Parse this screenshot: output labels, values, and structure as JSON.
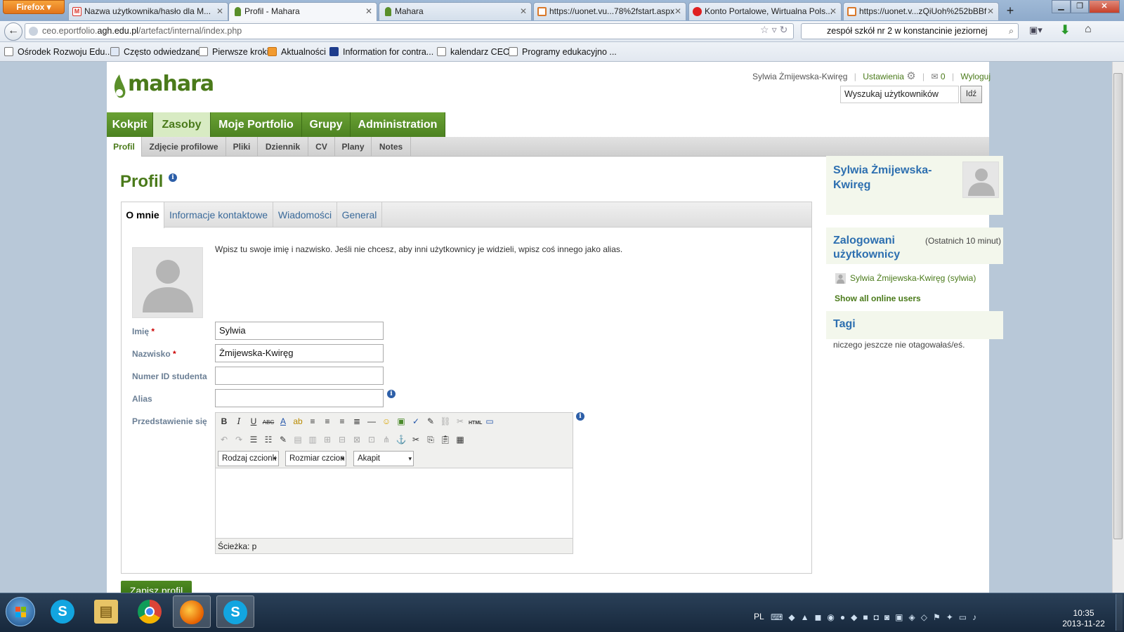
{
  "browser": {
    "firefox_label": "Firefox",
    "tabs": [
      {
        "label": "Nazwa użytkownika/hasło dla M...",
        "icon": "gmail-icon",
        "color": "#d93025"
      },
      {
        "label": "Profil - Mahara",
        "icon": "mahara-icon",
        "color": "#5a8f2a"
      },
      {
        "label": "Mahara",
        "icon": "mahara-icon",
        "color": "#5a8f2a"
      },
      {
        "label": "https://uonet.vu...78%2fstart.aspx",
        "icon": "uonet-icon",
        "color": "#d9792b"
      },
      {
        "label": "Konto Portalowe, Wirtualna Pols...",
        "icon": "wp-icon",
        "color": "#e02020"
      },
      {
        "label": "https://uonet.v...zQiUoh%252bBBf",
        "icon": "uonet-icon",
        "color": "#d9792b"
      }
    ],
    "new_tab": "+",
    "url_plain": "ceo.eportfolio.",
    "url_bold": "agh.edu.pl",
    "url_rest": "/artefact/internal/index.php",
    "search_value": "zespół szkół nr 2 w konstancinie jeziornej",
    "bookmarks": [
      "Ośrodek Rozwoju Edu...",
      "Często odwiedzane",
      "Pierwsze kroki",
      "Aktualności",
      "Information for contra...",
      "kalendarz CEO",
      "Programy edukacyjno ..."
    ]
  },
  "header": {
    "logo_text": "mahara",
    "user_name": "Sylwia Żmijewska-Kwiręg",
    "settings": "Ustawienia",
    "messages_count": "0",
    "logout": "Wyloguj",
    "search_placeholder": "Wyszukaj użytkowników",
    "search_button": "Idź"
  },
  "main_nav": [
    "Kokpit",
    "Zasoby",
    "Moje Portfolio",
    "Grupy",
    "Administration"
  ],
  "sub_nav": [
    "Profil",
    "Zdjęcie profilowe",
    "Pliki",
    "Dziennik",
    "CV",
    "Plany",
    "Notes"
  ],
  "content": {
    "title": "Profil",
    "tabs": [
      "O mnie",
      "Informacje kontaktowe",
      "Wiadomości",
      "General"
    ],
    "description": "Wpisz tu swoje imię i nazwisko. Jeśli nie chcesz, aby inni użytkownicy je widzieli, wpisz coś innego jako alias.",
    "fields": {
      "first_name_label": "Imię",
      "first_name_value": "Sylwia",
      "last_name_label": "Nazwisko",
      "last_name_value": "Żmijewska-Kwiręg",
      "student_id_label": "Numer ID studenta",
      "student_id_value": "",
      "alias_label": "Alias",
      "alias_value": "",
      "intro_label": "Przedstawienie się",
      "required_mark": "*"
    },
    "editor": {
      "font_family": "Rodzaj czcionk",
      "font_size": "Rozmiar czcion",
      "format": "Akapit",
      "path": "Ścieżka: p"
    },
    "save_button": "Zapisz profil"
  },
  "sidebar": {
    "profile_name": "Sylwia Żmijewska-Kwiręg",
    "online_title": "Zalogowani użytkownicy",
    "online_note": "(Ostatnich 10 minut)",
    "online_user": "Sylwia Żmijewska-Kwiręg (sylwia)",
    "show_all": "Show all online users",
    "tags_title": "Tagi",
    "tags_note": "niczego jeszcze nie otagowałaś/eś."
  },
  "taskbar": {
    "lang": "PL",
    "time": "10:35",
    "date": "2013-11-22"
  },
  "colors": {
    "accent_green": "#5a8f2a",
    "link_blue": "#2d6fb0"
  }
}
